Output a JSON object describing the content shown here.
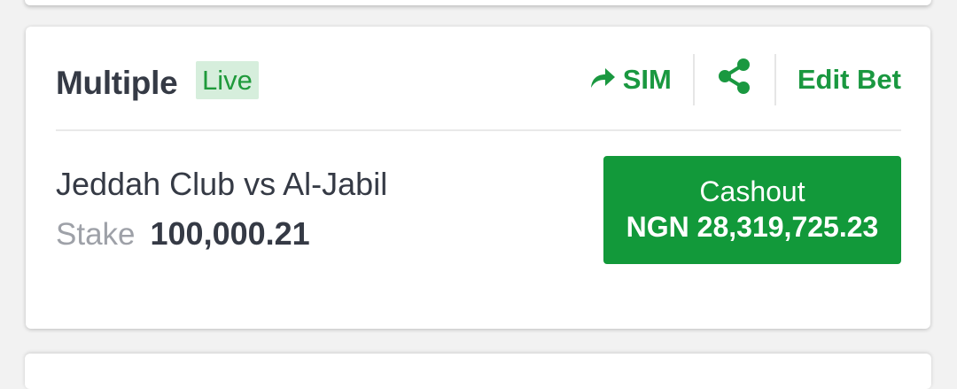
{
  "bet": {
    "type": "Multiple",
    "status_badge": "Live",
    "match": "Jeddah Club vs Al-Jabil",
    "stake_label": "Stake",
    "stake_value": "100,000.21"
  },
  "actions": {
    "sim_label": "SIM",
    "sim_icon": "forward-arrow-icon",
    "share_icon": "share-icon",
    "edit_label": "Edit Bet"
  },
  "cashout": {
    "label": "Cashout",
    "amount": "NGN 28,319,725.23"
  },
  "colors": {
    "accent_green": "#12993a",
    "text_green": "#1a9840",
    "badge_bg": "#d6eedc",
    "text_dark": "#353a45",
    "text_muted": "#9ea1a8"
  }
}
